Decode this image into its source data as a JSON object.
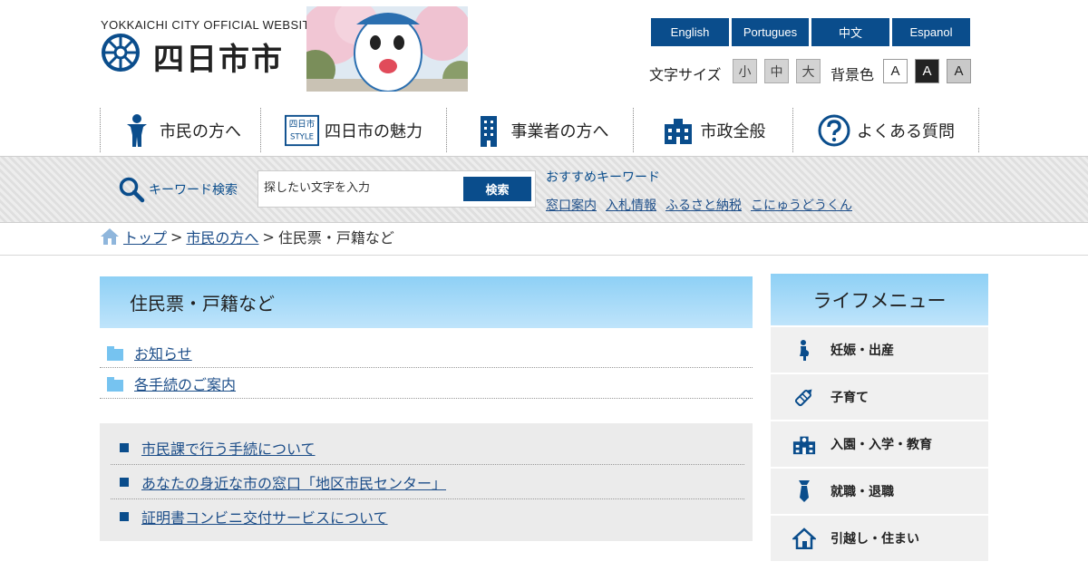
{
  "header": {
    "logo_en": "YOKKAICHI CITY OFFICIAL WEBSITE",
    "logo_jp": "四日市市",
    "languages": [
      "English",
      "Portugues",
      "中文",
      "Espanol"
    ],
    "font_size_label": "文字サイズ",
    "font_sizes": [
      "小",
      "中",
      "大"
    ],
    "bg_color_label": "背景色",
    "bg_colors": [
      "A",
      "A",
      "A"
    ]
  },
  "nav": {
    "items": [
      "市民の方へ",
      "四日市の魅力",
      "事業者の方へ",
      "市政全般",
      "よくある質問"
    ],
    "style_icon_top": "四日市",
    "style_icon_bottom": "STYLE"
  },
  "search": {
    "label": "キーワード検索",
    "placeholder": "探したい文字を入力",
    "button": "検索",
    "recommended_title": "おすすめキーワード",
    "recommended": [
      "窓口案内",
      "入札情報",
      "ふるさと納税",
      "こにゅうどうくん"
    ]
  },
  "breadcrumb": {
    "home": "トップ",
    "sep": ">",
    "parent": "市民の方へ",
    "current": "住民票・戸籍など"
  },
  "main": {
    "title": "住民票・戸籍など",
    "categories": [
      "お知らせ",
      "各手続のご案内"
    ],
    "links": [
      "市民課で行う手続について",
      "あなたの身近な市の窓口「地区市民センター」",
      "証明書コンビニ交付サービスについて"
    ]
  },
  "life_menu": {
    "title": "ライフメニュー",
    "items": [
      "妊娠・出産",
      "子育て",
      "入園・入学・教育",
      "就職・退職",
      "引越し・住まい"
    ]
  },
  "colors": {
    "brand_blue": "#0a4d8c",
    "light_blue": "#8ed0f5",
    "link": "#1d4e89"
  }
}
